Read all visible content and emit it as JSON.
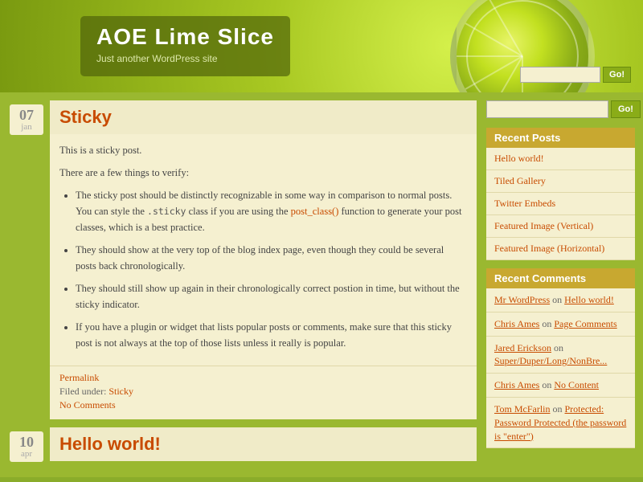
{
  "header": {
    "title": "AOE Lime Slice",
    "tagline": "Just another WordPress site",
    "search_placeholder": "",
    "search_button": "Go!",
    "sidebar_search_button": "Go!"
  },
  "posts": [
    {
      "date_day": "07",
      "date_month": "jan",
      "title": "Sticky",
      "intro1": "This is a sticky post.",
      "intro2": "There are a few things to verify:",
      "bullets": [
        "The sticky post should be distinctly recognizable in some way in comparison to normal posts. You can style the .sticky class if you are using the post_class() function to generate your post classes, which is a best practice.",
        "They should show at the very top of the blog index page, even though they could be several posts back chronologically.",
        "They should still show up again in their chronologically correct postion in time, but without the sticky indicator.",
        "If you have a plugin or widget that lists popular posts or comments, make sure that this sticky post is not always at the top of those lists unless it really is popular."
      ],
      "permalink_label": "Permalink",
      "filed_under": "Filed under:",
      "category": "Sticky",
      "comments": "No Comments"
    },
    {
      "date_day": "10",
      "date_month": "apr",
      "title": "Hello world!",
      "intro1": "",
      "intro2": "",
      "bullets": []
    }
  ],
  "sidebar": {
    "search_placeholder": "",
    "recent_posts_title": "Recent Posts",
    "recent_posts": [
      "Hello world!",
      "Tiled Gallery",
      "Twitter Embeds",
      "Featured Image (Vertical)",
      "Featured Image (Horizontal)"
    ],
    "recent_comments_title": "Recent Comments",
    "recent_comments": [
      {
        "author": "Mr WordPress",
        "on_text": "on",
        "post": "Hello world!"
      },
      {
        "author": "Chris Ames",
        "on_text": "on",
        "post": "Page Comments"
      },
      {
        "author": "Jared Erickson",
        "on_text": "on",
        "post": "Super/Duper/Long/NonBre..."
      },
      {
        "author": "Chris Ames",
        "on_text": "on",
        "post": "No Content"
      },
      {
        "author": "Tom McFarlin",
        "on_text": "on",
        "post": "Protected: Password Protected (the password is \"enter\")"
      }
    ]
  }
}
